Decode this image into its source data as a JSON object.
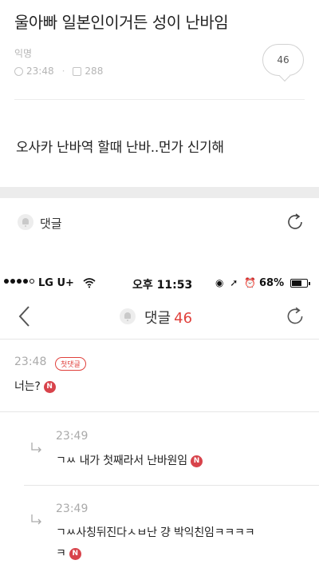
{
  "post": {
    "title": "울아빠 일본인이거든 성이 난바임",
    "author": "익명",
    "time": "23:48",
    "views": "288",
    "comment_count": "46",
    "body": "오사카 난바역 할때 난바..먼가 신기해"
  },
  "comment_bar": {
    "label": "댓글"
  },
  "status_bar": {
    "carrier": "LG U+",
    "time": "오후 11:53",
    "battery": "68%",
    "battery_level": 0.68
  },
  "nav": {
    "title": "댓글",
    "count": "46"
  },
  "comments": [
    {
      "time": "23:48",
      "badge": "첫댓글",
      "text": "너는?",
      "badge_n": "N"
    }
  ],
  "replies": [
    {
      "time": "23:49",
      "text": "ㄱㅆ 내가 첫째라서 난바원임",
      "badge_n": "N"
    },
    {
      "time": "23:49",
      "text_line1": "ㄱㅆ사칭뒤진다ㅅㅂ난 걍 박익친임ㅋㅋㅋㅋ",
      "text_line2": "ㅋ",
      "badge_n": "N"
    }
  ],
  "icons": {
    "clock": "clock-icon",
    "views": "views-icon",
    "bell": "bell-icon",
    "refresh": "refresh-icon",
    "back": "back-chevron-icon",
    "reply": "reply-arrow-icon",
    "wifi": "wifi-icon",
    "battery": "battery-icon"
  },
  "colors": {
    "accent": "#e0413c",
    "badge_bg": "#d8434b",
    "muted": "#b5b5b5"
  }
}
